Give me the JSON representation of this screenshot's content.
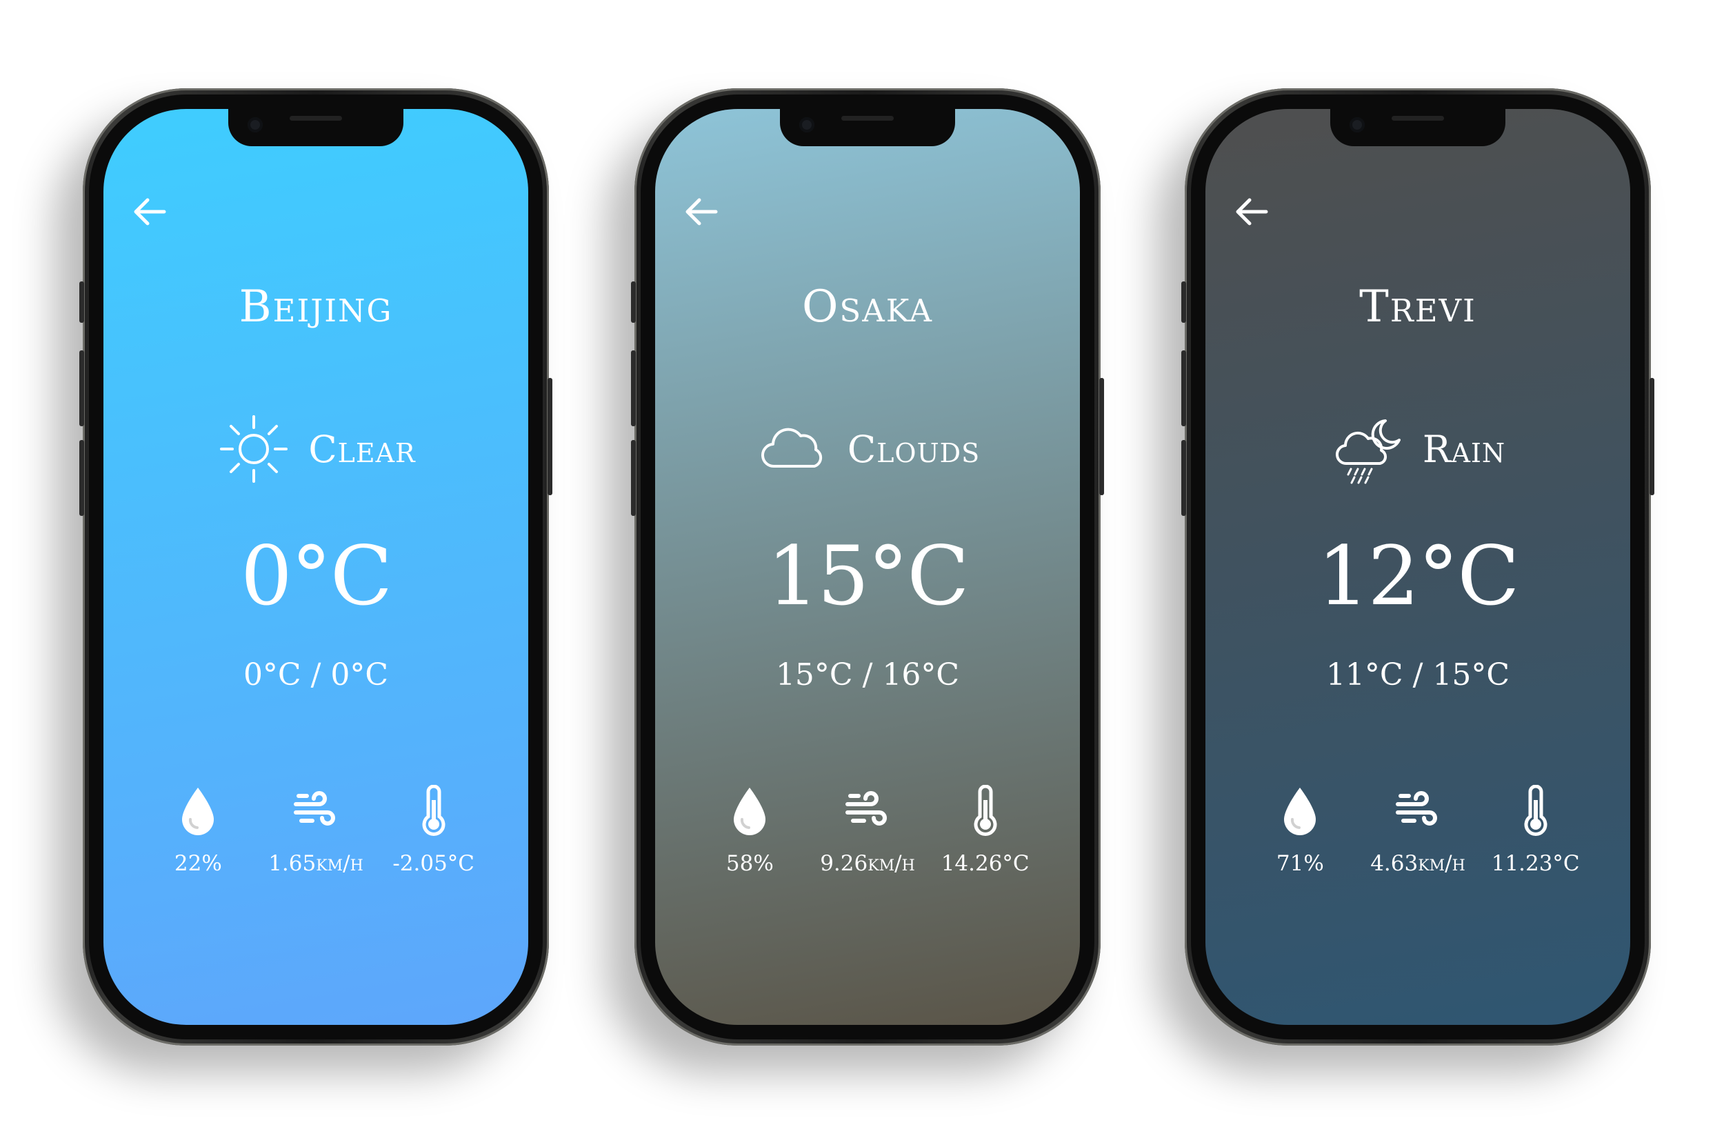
{
  "phones": [
    {
      "city": "Beijing",
      "condition": "Clear",
      "condition_icon": "sun-icon",
      "temperature": "0°C",
      "range": "0°C / 0°C",
      "stats": {
        "humidity": "22%",
        "wind": "1.65km/h",
        "feels_like": "-2.05°C"
      },
      "gradient": [
        "#3fcdfe",
        "#5ea6fb"
      ]
    },
    {
      "city": "Osaka",
      "condition": "Clouds",
      "condition_icon": "cloud-icon",
      "temperature": "15°C",
      "range": "15°C / 16°C",
      "stats": {
        "humidity": "58%",
        "wind": "9.26km/h",
        "feels_like": "14.26°C"
      },
      "gradient": [
        "#8ec4d8",
        "#5a5447"
      ]
    },
    {
      "city": "Trevi",
      "condition": "Rain",
      "condition_icon": "cloud-moon-rain-icon",
      "temperature": "12°C",
      "range": "11°C / 15°C",
      "stats": {
        "humidity": "71%",
        "wind": "4.63km/h",
        "feels_like": "11.23°C"
      },
      "gradient": [
        "#4f4f4f",
        "#2f5672"
      ]
    }
  ]
}
